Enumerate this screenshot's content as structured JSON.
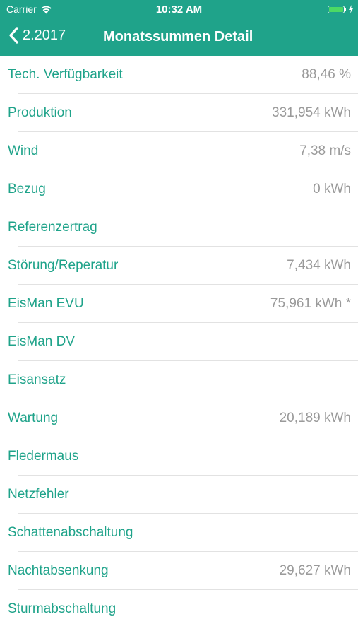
{
  "status_bar": {
    "carrier": "Carrier",
    "time": "10:32 AM",
    "battery_level": 1.0
  },
  "nav": {
    "back_label": "2.2017",
    "title": "Monatssummen Detail"
  },
  "rows": [
    {
      "label": "Tech. Verfügbarkeit",
      "value": "88,46 %"
    },
    {
      "label": "Produktion",
      "value": "331,954 kWh"
    },
    {
      "label": "Wind",
      "value": "7,38 m/s"
    },
    {
      "label": "Bezug",
      "value": "0 kWh"
    },
    {
      "label": "Referenzertrag",
      "value": ""
    },
    {
      "label": "Störung/Reperatur",
      "value": "7,434 kWh"
    },
    {
      "label": "EisMan EVU",
      "value": "75,961 kWh *"
    },
    {
      "label": "EisMan DV",
      "value": ""
    },
    {
      "label": "Eisansatz",
      "value": ""
    },
    {
      "label": "Wartung",
      "value": "20,189 kWh"
    },
    {
      "label": "Fledermaus",
      "value": ""
    },
    {
      "label": "Netzfehler",
      "value": ""
    },
    {
      "label": "Schattenabschaltung",
      "value": ""
    },
    {
      "label": "Nachtabsenkung",
      "value": "29,627 kWh"
    },
    {
      "label": "Sturmabschaltung",
      "value": ""
    }
  ],
  "colors": {
    "accent": "#1fa38a",
    "value_text": "#9a9a9a",
    "separator": "#e2e2e2",
    "battery": "#4cd964"
  },
  "icons": {
    "wifi": "wifi-icon",
    "battery": "battery-icon",
    "charging": "charging-bolt-icon",
    "back": "chevron-left-icon"
  }
}
